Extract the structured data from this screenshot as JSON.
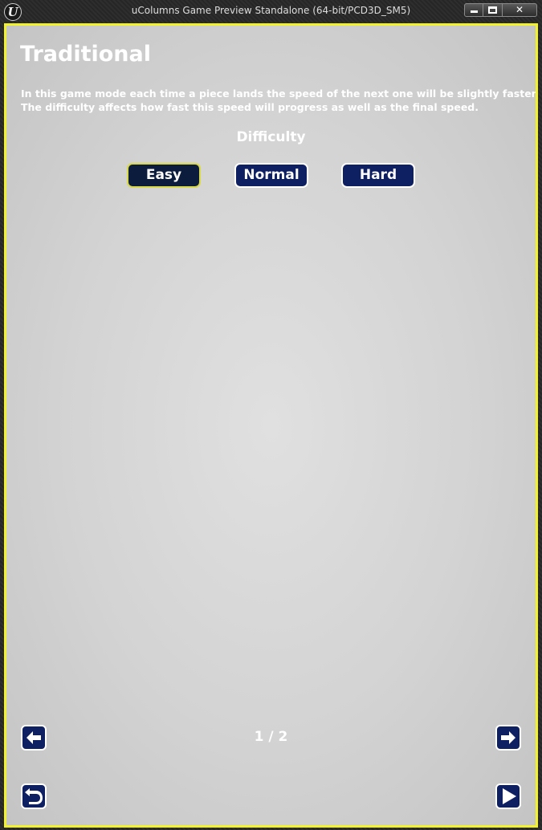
{
  "window": {
    "title": "uColumns Game Preview Standalone (64-bit/PCD3D_SM5)",
    "logo_text": "U",
    "controls": {
      "minimize_icon": "minimize-icon",
      "maximize_icon": "maximize-icon",
      "close_label": "✕"
    },
    "frame_accent": "#f2f22c"
  },
  "screen": {
    "title": "Traditional",
    "description_lines": [
      "In this game mode each time a piece lands the speed of the next one will be slightly faster.",
      "The difficulty affects how fast this speed will progress as well as the final speed."
    ],
    "difficulty_label": "Difficulty",
    "difficulty_options": [
      {
        "label": "Easy",
        "selected": true
      },
      {
        "label": "Normal",
        "selected": false
      },
      {
        "label": "Hard",
        "selected": false
      }
    ],
    "page_indicator": "1 / 2",
    "nav": {
      "prev_icon": "arrow-left-icon",
      "next_icon": "arrow-right-icon",
      "back_icon": "return-icon",
      "play_icon": "play-icon"
    }
  },
  "colors": {
    "button_fill": "#0e1f62",
    "selected_button_fill": "#0b1c3c",
    "selected_border": "#d9d94a",
    "text": "#ffffff"
  }
}
